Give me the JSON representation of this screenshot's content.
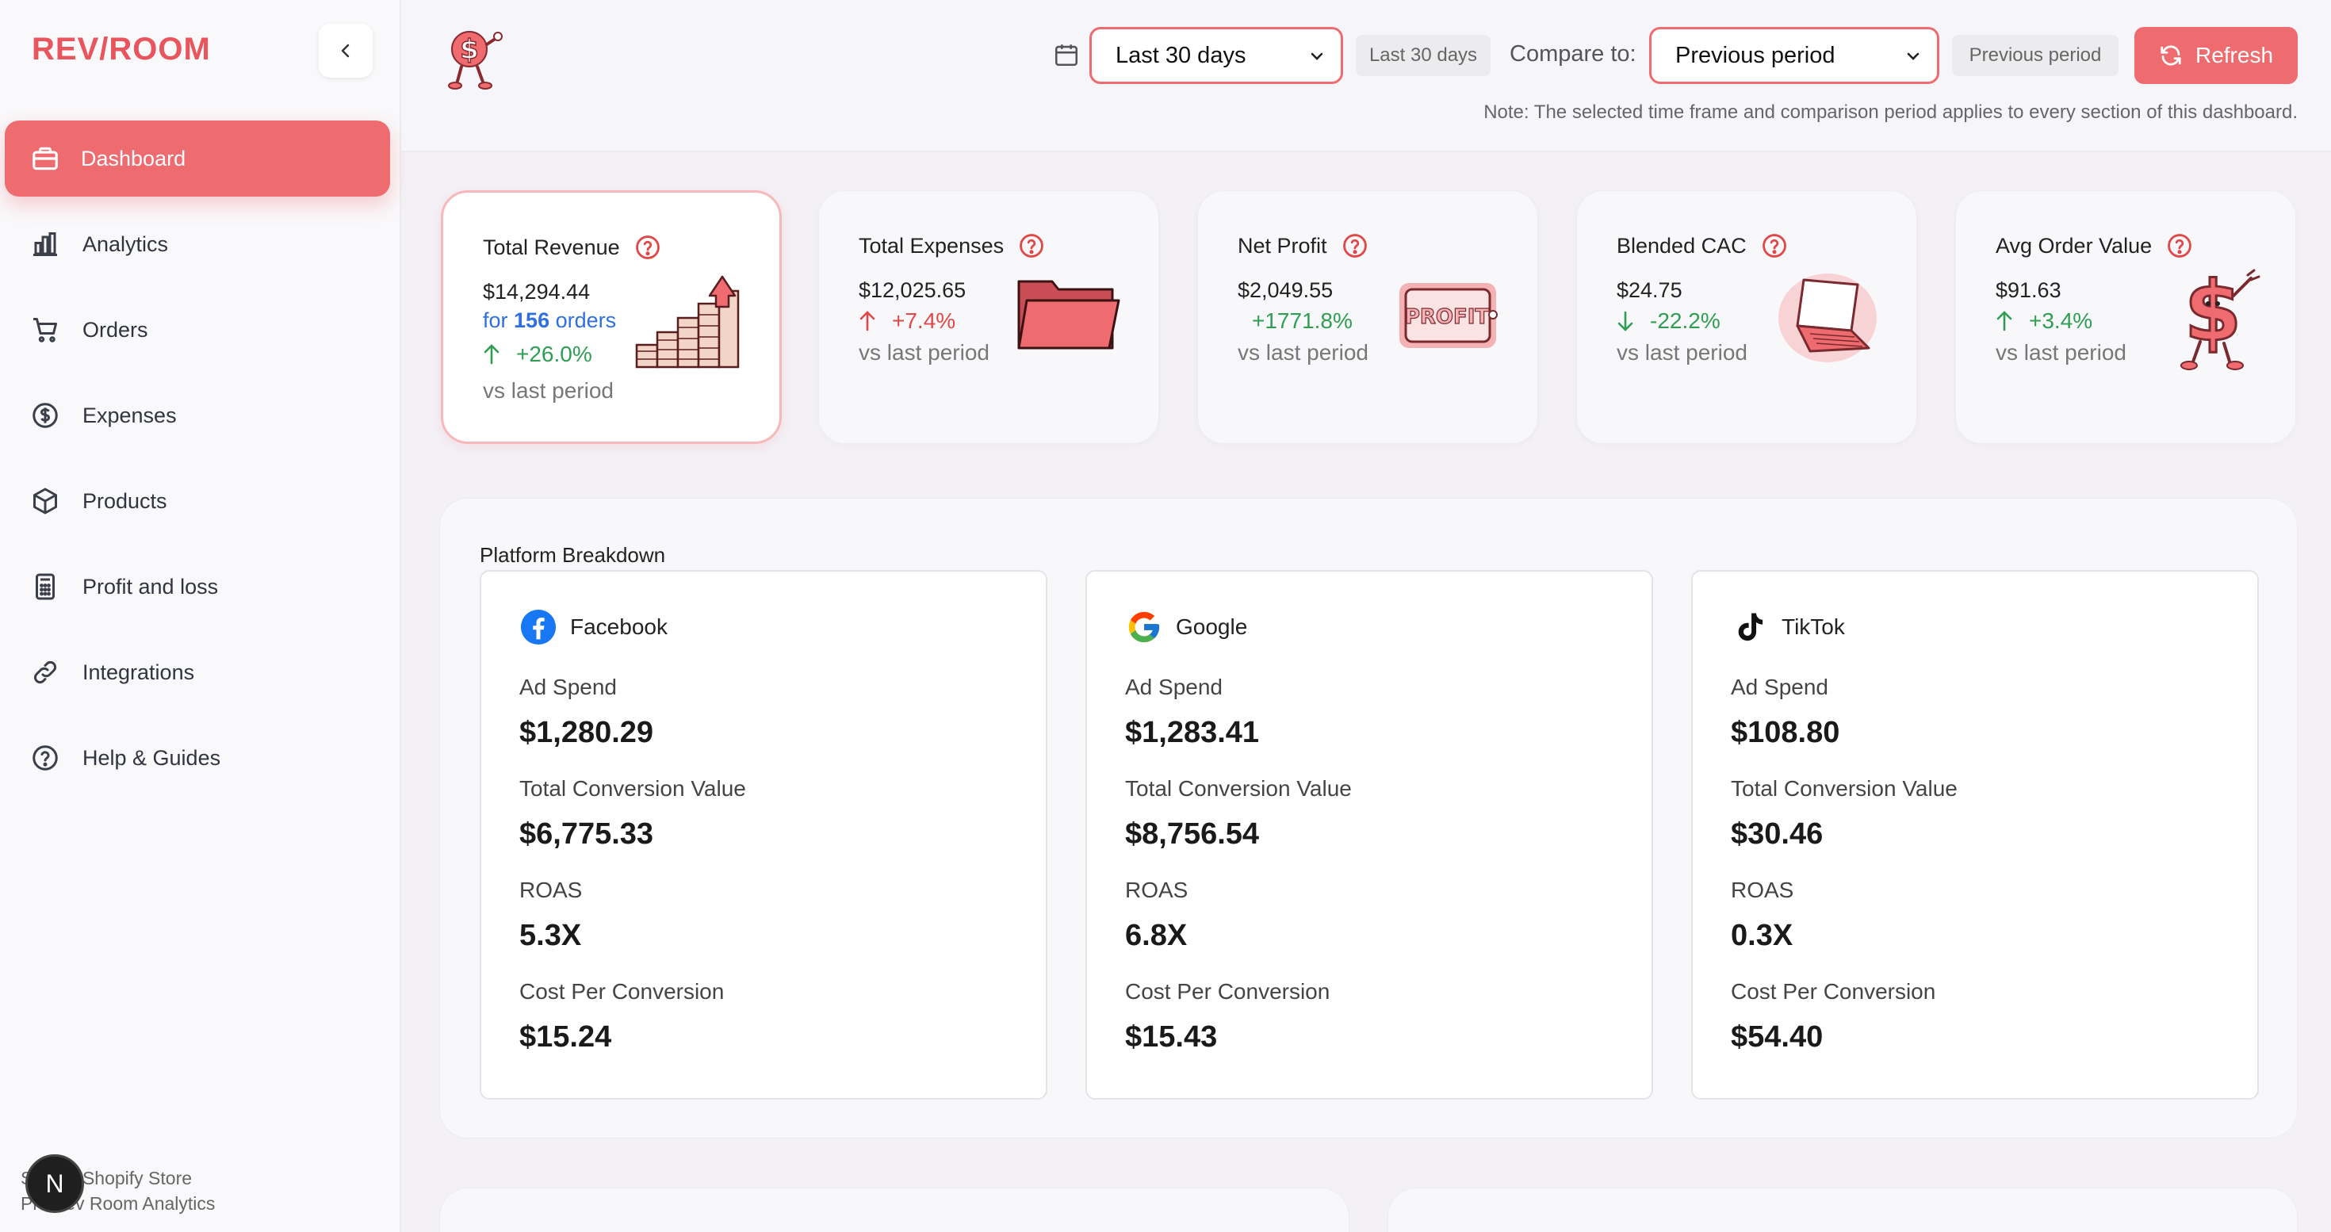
{
  "brand": {
    "logo_text": "REV/ROOM",
    "accent": "#ee6b70"
  },
  "sidebar": {
    "collapse_icon": "chevron-left-icon",
    "items": [
      {
        "label": "Dashboard",
        "icon": "briefcase-icon",
        "active": true
      },
      {
        "label": "Analytics",
        "icon": "bar-chart-icon"
      },
      {
        "label": "Orders",
        "icon": "cart-icon"
      },
      {
        "label": "Expenses",
        "icon": "dollar-circle-icon"
      },
      {
        "label": "Products",
        "icon": "box-icon"
      },
      {
        "label": "Profit and loss",
        "icon": "calculator-icon"
      },
      {
        "label": "Integrations",
        "icon": "link-icon"
      },
      {
        "label": "Help & Guides",
        "icon": "help-circle-icon"
      }
    ],
    "store_line1": "S    My Shopify Store",
    "store_line2": "Pl   Rev Room Analytics",
    "avatar_initial": "N"
  },
  "header": {
    "time_frame": {
      "selected": "Last 30 days",
      "badge": "Last 30 days"
    },
    "compare": {
      "label": "Compare to:",
      "selected": "Previous period",
      "badge": "Previous period"
    },
    "refresh_label": "Refresh",
    "note": "Note: The selected time frame and comparison period applies to every section of this dashboard."
  },
  "metrics": [
    {
      "title": "Total Revenue",
      "value": "$14,294.44",
      "orders_prefix": "for",
      "orders_count": "156",
      "orders_suffix": "orders",
      "change": "+26.0%",
      "direction": "up",
      "tone": "positive",
      "vs": "vs last period",
      "icon": "revenue-stairs-icon"
    },
    {
      "title": "Total Expenses",
      "value": "$12,025.65",
      "change": "+7.4%",
      "direction": "up",
      "tone": "negative",
      "vs": "vs last period",
      "icon": "folder-icon"
    },
    {
      "title": "Net Profit",
      "value": "$2,049.55",
      "change": "+1771.8%",
      "direction": "none",
      "tone": "positive",
      "vs": "vs last period",
      "icon": "profit-sign-icon"
    },
    {
      "title": "Blended CAC",
      "value": "$24.75",
      "change": "-22.2%",
      "direction": "down",
      "tone": "positive",
      "vs": "vs last period",
      "icon": "laptop-icon"
    },
    {
      "title": "Avg Order Value",
      "value": "$91.63",
      "change": "+3.4%",
      "direction": "up",
      "tone": "positive",
      "vs": "vs last period",
      "icon": "dollar-mascot-icon"
    }
  ],
  "platform": {
    "title": "Platform Breakdown",
    "labels": {
      "ad_spend": "Ad Spend",
      "conversion_value": "Total Conversion Value",
      "roas": "ROAS",
      "cost_per_conversion": "Cost Per Conversion"
    },
    "cards": [
      {
        "name": "Facebook",
        "icon": "facebook-icon",
        "ad_spend": "$1,280.29",
        "conversion_value": "$6,775.33",
        "roas": "5.3X",
        "cost_per_conversion": "$15.24"
      },
      {
        "name": "Google",
        "icon": "google-icon",
        "ad_spend": "$1,283.41",
        "conversion_value": "$8,756.54",
        "roas": "6.8X",
        "cost_per_conversion": "$15.43"
      },
      {
        "name": "TikTok",
        "icon": "tiktok-icon",
        "ad_spend": "$108.80",
        "conversion_value": "$30.46",
        "roas": "0.3X",
        "cost_per_conversion": "$54.40"
      }
    ]
  }
}
